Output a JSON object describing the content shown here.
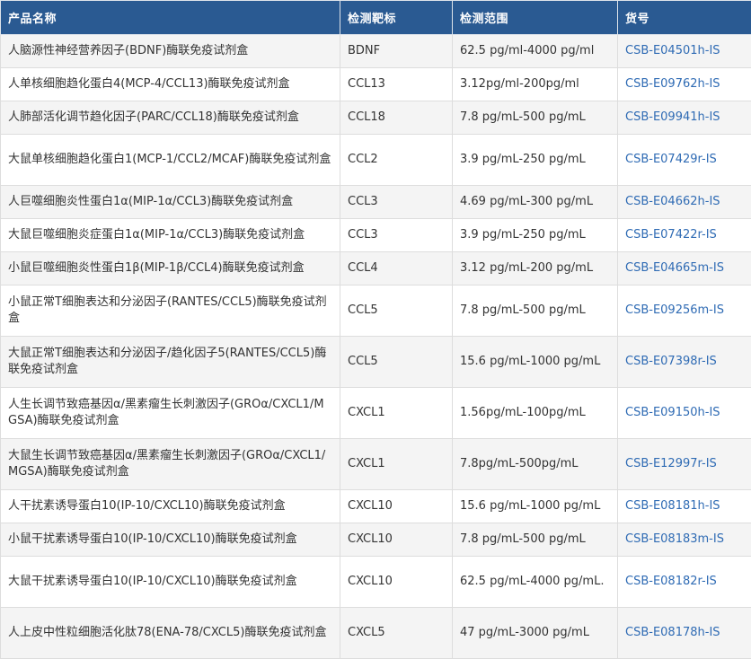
{
  "headers": [
    "产品名称",
    "检测靶标",
    "检测范围",
    "货号"
  ],
  "rows": [
    {
      "name": "人脑源性神经营养因子(BDNF)酶联免疫试剂盒",
      "target": "BDNF",
      "range": "62.5 pg/ml-4000 pg/ml",
      "code": "CSB-E04501h-IS"
    },
    {
      "name": "人单核细胞趋化蛋白4(MCP-4/CCL13)酶联免疫试剂盒",
      "target": "CCL13",
      "range": "3.12pg/ml-200pg/ml",
      "code": "CSB-E09762h-IS"
    },
    {
      "name": "人肺部活化调节趋化因子(PARC/CCL18)酶联免疫试剂盒",
      "target": "CCL18",
      "range": "7.8 pg/mL-500 pg/mL",
      "code": "CSB-E09941h-IS"
    },
    {
      "name": "大鼠单核细胞趋化蛋白1(MCP-1/CCL2/MCAF)酶联免疫试剂盒",
      "target": "CCL2",
      "range": "3.9 pg/mL-250 pg/mL",
      "code": "CSB-E07429r-IS"
    },
    {
      "name": "人巨噬细胞炎性蛋白1α(MIP-1α/CCL3)酶联免疫试剂盒",
      "target": "CCL3",
      "range": "4.69 pg/mL-300 pg/mL",
      "code": "CSB-E04662h-IS"
    },
    {
      "name": "大鼠巨噬细胞炎症蛋白1α(MIP-1α/CCL3)酶联免疫试剂盒",
      "target": "CCL3",
      "range": "3.9 pg/mL-250 pg/mL",
      "code": "CSB-E07422r-IS"
    },
    {
      "name": "小鼠巨噬细胞炎性蛋白1β(MIP-1β/CCL4)酶联免疫试剂盒",
      "target": "CCL4",
      "range": "3.12 pg/mL-200 pg/mL",
      "code": "CSB-E04665m-IS"
    },
    {
      "name": "小鼠正常T细胞表达和分泌因子(RANTES/CCL5)酶联免疫试剂盒",
      "target": "CCL5",
      "range": "7.8 pg/mL-500 pg/mL",
      "code": "CSB-E09256m-IS"
    },
    {
      "name": "大鼠正常T细胞表达和分泌因子/趋化因子5(RANTES/CCL5)酶联免疫试剂盒",
      "target": "CCL5",
      "range": "15.6 pg/mL-1000 pg/mL",
      "code": "CSB-E07398r-IS"
    },
    {
      "name": "人生长调节致癌基因α/黑素瘤生长刺激因子(GROα/CXCL1/MGSA)酶联免疫试剂盒",
      "target": "CXCL1",
      "range": "1.56pg/mL-100pg/mL",
      "code": "CSB-E09150h-IS"
    },
    {
      "name": "大鼠生长调节致癌基因α/黑素瘤生长刺激因子(GROα/CXCL1/MGSA)酶联免疫试剂盒",
      "target": "CXCL1",
      "range": "7.8pg/mL-500pg/mL",
      "code": "CSB-E12997r-IS"
    },
    {
      "name": "人干扰素诱导蛋白10(IP-10/CXCL10)酶联免疫试剂盒",
      "target": "CXCL10",
      "range": "15.6 pg/mL-1000 pg/mL",
      "code": "CSB-E08181h-IS"
    },
    {
      "name": "小鼠干扰素诱导蛋白10(IP-10/CXCL10)酶联免疫试剂盒",
      "target": "CXCL10",
      "range": "7.8 pg/mL-500 pg/mL",
      "code": "CSB-E08183m-IS"
    },
    {
      "name": "大鼠干扰素诱导蛋白10(IP-10/CXCL10)酶联免疫试剂盒",
      "target": "CXCL10",
      "range": "62.5 pg/mL-4000 pg/mL.",
      "code": "CSB-E08182r-IS"
    },
    {
      "name": "人上皮中性粒细胞活化肽78(ENA-78/CXCL5)酶联免疫试剂盒",
      "target": "CXCL5",
      "range": "47 pg/mL-3000 pg/mL",
      "code": "CSB-E08178h-IS"
    }
  ]
}
